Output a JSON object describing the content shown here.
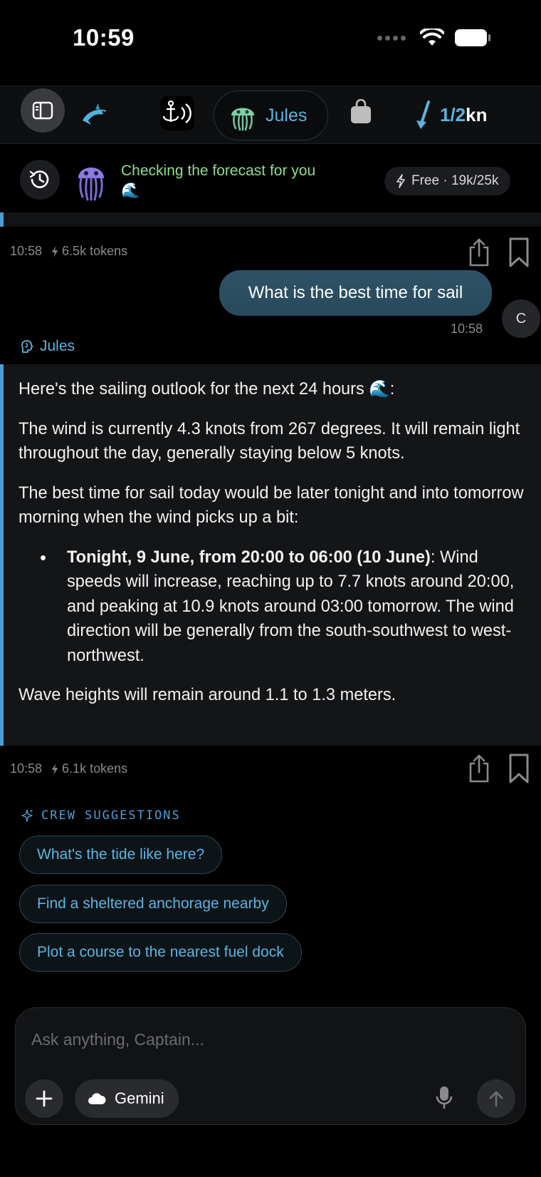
{
  "status_bar": {
    "time": "10:59"
  },
  "toolbar": {
    "active_agent": "Jules",
    "wind_fraction": "1/2",
    "wind_unit": "kn"
  },
  "agent_status": {
    "text": "Checking the forecast for you",
    "emoji": "🌊",
    "plan_badge": "Free · 19k/25k"
  },
  "messages": {
    "first_meta": {
      "time": "10:58",
      "tokens": "6.5k tokens"
    },
    "user": {
      "text": "What is the best time for sail",
      "time": "10:58",
      "avatar_initial": "C"
    },
    "assistant": {
      "agent_name": "Jules",
      "intro": "Here's the sailing outlook for the next 24 hours 🌊:",
      "para1": "The wind is currently 4.3 knots from 267 degrees. It will remain light throughout the day, generally staying below 5 knots.",
      "para2": "The best time for sail today would be later tonight and into tomorrow morning when the wind picks up a bit:",
      "bullet_bold": "Tonight, 9 June, from 20:00 to 06:00 (10 June)",
      "bullet_rest": ": Wind speeds will increase, reaching up to 7.7 knots around 20:00, and peaking at 10.9 knots around 03:00 tomorrow. The wind direction will be generally from the south-southwest to west-northwest.",
      "para3": "Wave heights will remain around 1.1 to 1.3 meters."
    },
    "second_meta": {
      "time": "10:58",
      "tokens": "6.1k tokens"
    }
  },
  "suggestions": {
    "header": "CREW SUGGESTIONS",
    "items": [
      "What's the tide like here?",
      "Find a sheltered anchorage nearby",
      "Plot a course to the nearest fuel dock"
    ]
  },
  "composer": {
    "placeholder": "Ask anything, Captain...",
    "model_label": "Gemini"
  },
  "colors": {
    "accent": "#5cb4e0",
    "accent_bar": "#4b9ed3",
    "status_green": "#8fdc8f",
    "bubble": "#2f5266",
    "background": "#000000"
  },
  "icons": {
    "sidebar_toggle": "sidebar-icon",
    "dolphin": "dolphin-icon",
    "anchor_radio": "anchor-signal-icon",
    "jellyfish": "jellyfish-icon",
    "bag": "bag-icon",
    "wind_arrow": "wind-arrow-icon",
    "history": "history-icon",
    "bolt": "bolt-icon",
    "share": "share-icon",
    "bookmark": "bookmark-icon",
    "sparkle": "sparkle-icon",
    "plus": "plus-icon",
    "cloud": "cloud-icon",
    "mic": "mic-icon",
    "send": "arrow-up-icon"
  }
}
